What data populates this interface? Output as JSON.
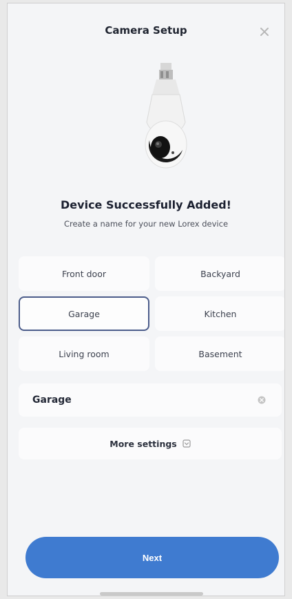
{
  "header": {
    "title": "Camera Setup"
  },
  "status": {
    "headline": "Device Successfully Added!",
    "subline": "Create a name for your new Lorex device"
  },
  "name_options": [
    {
      "label": "Front door",
      "selected": false
    },
    {
      "label": "Backyard",
      "selected": false
    },
    {
      "label": "Garage",
      "selected": true
    },
    {
      "label": "Kitchen",
      "selected": false
    },
    {
      "label": "Living room",
      "selected": false
    },
    {
      "label": "Basement",
      "selected": false
    }
  ],
  "name_field": {
    "value": "Garage"
  },
  "more_settings": {
    "label": "More settings"
  },
  "next_button": {
    "label": "Next"
  },
  "colors": {
    "accent": "#3f7bd0",
    "selected_border": "#4b5c8a",
    "background": "#f4f5f7"
  }
}
